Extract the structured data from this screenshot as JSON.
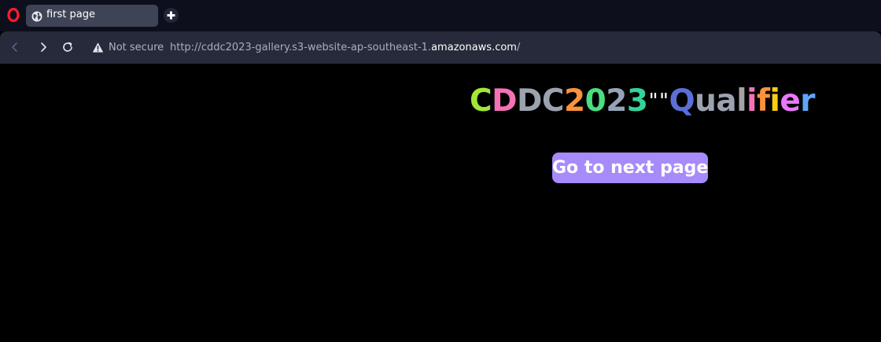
{
  "browser": {
    "tab": {
      "title": "first page"
    },
    "address_bar": {
      "security_label": "Not secure",
      "url_scheme": "http://",
      "url_host": "cddc2023-gallery.s3-website-ap-southeast-1.amazonaws.com",
      "url_path": "/"
    },
    "colors": {
      "tabstrip_bg": "#0d0f1c",
      "active_tab_bg": "#3e4356",
      "toolbar_bg": "#262a3a",
      "opera_logo": "#ff1b2d"
    },
    "icons": [
      "opera-logo-icon",
      "globe-icon",
      "plus-icon",
      "back-arrow-icon",
      "forward-arrow-icon",
      "reload-icon",
      "warning-triangle-icon"
    ]
  },
  "page": {
    "heading": {
      "chars": [
        {
          "ch": "C",
          "color": "#a3e635"
        },
        {
          "ch": "D",
          "color": "#f472b6"
        },
        {
          "ch": "D",
          "color": "#9ca3af"
        },
        {
          "ch": "C",
          "color": "#9ca3af"
        },
        {
          "ch": "2",
          "color": "#fb923c"
        },
        {
          "ch": "0",
          "color": "#4ade80"
        },
        {
          "ch": "2",
          "color": "#94a3b8"
        },
        {
          "ch": "3",
          "color": "#34d399"
        },
        {
          "ch": "\"",
          "color": "#ffffff",
          "quote": true
        },
        {
          "ch": "\"",
          "color": "#ffffff",
          "quote": true
        },
        {
          "ch": "Q",
          "color": "#5b6fd6"
        },
        {
          "ch": "u",
          "color": "#9ca3af"
        },
        {
          "ch": "a",
          "color": "#9ca3af"
        },
        {
          "ch": "l",
          "color": "#a3a3a3"
        },
        {
          "ch": "i",
          "color": "#f472b6"
        },
        {
          "ch": "f",
          "color": "#fb923c"
        },
        {
          "ch": "i",
          "color": "#facc15"
        },
        {
          "ch": "e",
          "color": "#e879f9"
        },
        {
          "ch": "r",
          "color": "#60a5fa"
        }
      ]
    },
    "next_button": {
      "label": "Go to next page",
      "bg": "#a78bfa"
    }
  }
}
